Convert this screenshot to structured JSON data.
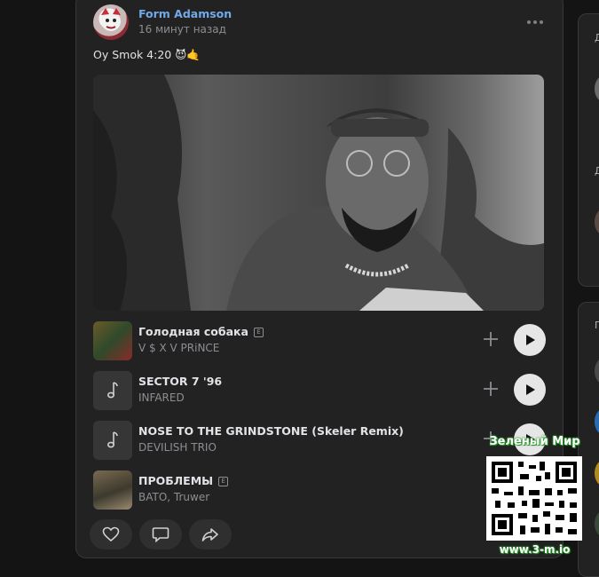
{
  "post": {
    "author": "Form Adamson",
    "time": "16 минут назад",
    "text": "Oy Smok 4:20 😈🤙"
  },
  "tracks": [
    {
      "title": "Голодная собака",
      "artist": "V $ X V PRiNCE",
      "explicit": true,
      "explicit_label": "E"
    },
    {
      "title": "SECTOR 7 '96",
      "artist": "INFARED",
      "explicit": false
    },
    {
      "title": "NOSE TO THE GRINDSTONE (Skeler Remix)",
      "artist": "DEVILISH TRIO",
      "explicit": false
    },
    {
      "title": "ПРОБЛЕМЫ",
      "artist": "BATO, Truwer",
      "explicit": true,
      "explicit_label": "E"
    }
  ],
  "actions": {
    "like_icon": "heart-icon",
    "comment_icon": "comment-icon",
    "share_icon": "share-icon"
  },
  "watermark": {
    "title": "Зеленый Мир",
    "url": "www.3-m.io"
  },
  "sidebar": {
    "letters": [
      "Д",
      "Д",
      "П"
    ]
  },
  "colors": {
    "link": "#71aaeb",
    "card": "#222222",
    "background": "#141414",
    "play": "#e6e6e6"
  }
}
